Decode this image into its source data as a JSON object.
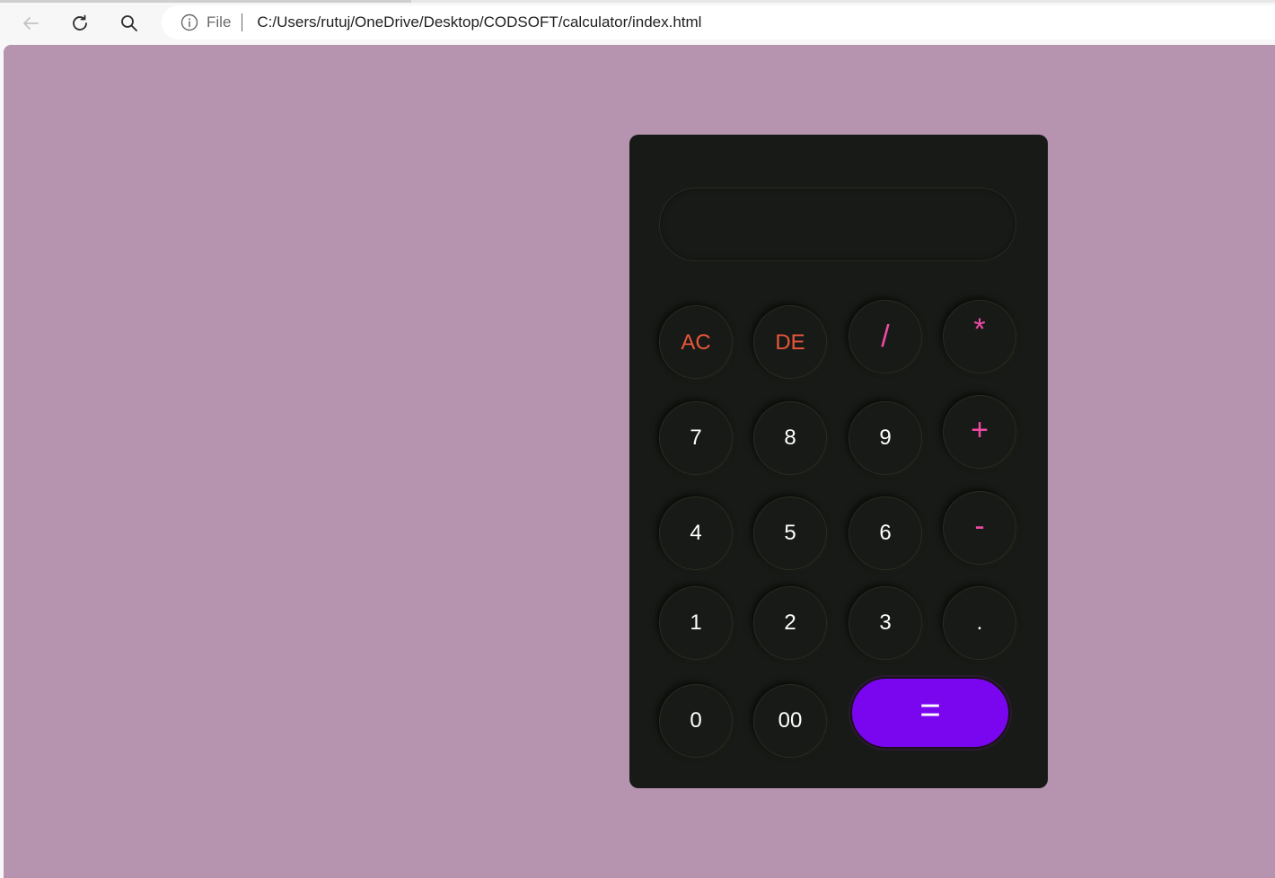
{
  "browser": {
    "file_label": "File",
    "url": "C:/Users/rutuj/OneDrive/Desktop/CODSOFT/calculator/index.html"
  },
  "calculator": {
    "display_value": "",
    "keys": {
      "ac": "AC",
      "de": "DE",
      "divide": "/",
      "multiply": "*",
      "seven": "7",
      "eight": "8",
      "nine": "9",
      "plus": "+",
      "four": "4",
      "five": "5",
      "six": "6",
      "minus": "-",
      "one": "1",
      "two": "2",
      "three": "3",
      "dot": ".",
      "zero": "0",
      "double_zero": "00",
      "equals": "="
    },
    "colors": {
      "page_background": "#b693af",
      "body": "#171a16",
      "function_text": "#e8573a",
      "operator_text": "#f04aa6",
      "equals_background": "#7a06f0"
    }
  }
}
